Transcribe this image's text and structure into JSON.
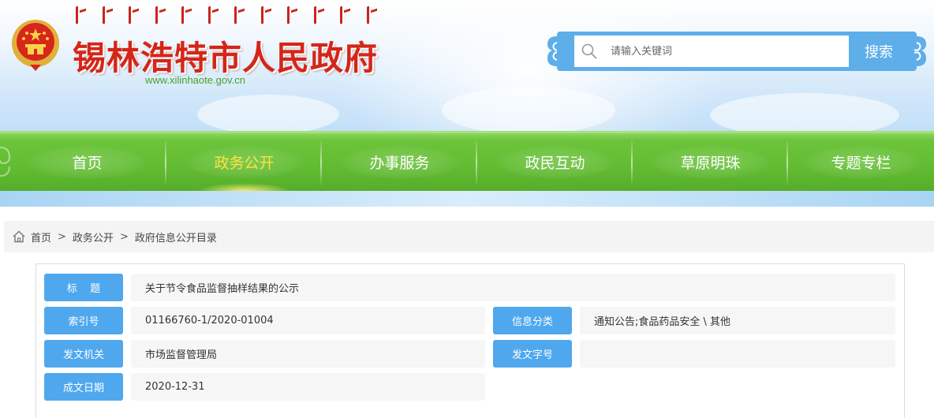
{
  "header": {
    "site_title": "锡林浩特市人民政府",
    "site_url": "www.xilinhaote.gov.cn",
    "search": {
      "placeholder": "请输入关键词",
      "button_label": "搜索"
    }
  },
  "nav": {
    "items": [
      {
        "label": "首页",
        "active": false
      },
      {
        "label": "政务公开",
        "active": true
      },
      {
        "label": "办事服务",
        "active": false
      },
      {
        "label": "政民互动",
        "active": false
      },
      {
        "label": "草原明珠",
        "active": false
      },
      {
        "label": "专题专栏",
        "active": false
      }
    ],
    "active_color": "#ffe33a"
  },
  "breadcrumb": {
    "items": [
      "首页",
      "政务公开",
      "政府信息公开目录"
    ],
    "separator": ">"
  },
  "info": {
    "title_label": "标    题",
    "title_value": "关于节令食品监督抽样结果的公示",
    "index_label": "索引号",
    "index_value": "01166760-1/2020-01004",
    "category_label": "信息分类",
    "category_value": "通知公告;食品药品安全 \\ 其他",
    "issuer_label": "发文机关",
    "issuer_value": "市场监督管理局",
    "docno_label": "发文字号",
    "docno_value": "",
    "date_label": "成文日期",
    "date_value": "2020-12-31"
  },
  "colors": {
    "title_red": "#d42618",
    "nav_green": "#62bc32",
    "label_blue": "#4fa8ee",
    "search_blue": "#5eaeea"
  }
}
